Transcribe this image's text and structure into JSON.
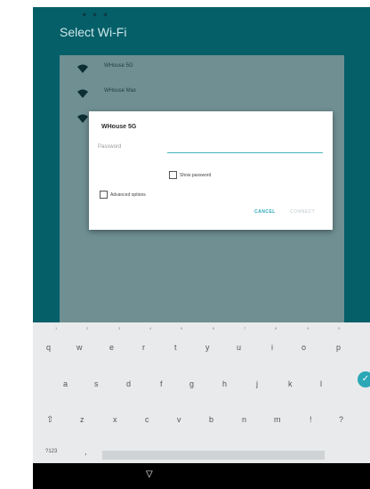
{
  "header": {
    "title": "Select Wi-Fi"
  },
  "networks": [
    {
      "name": "WHouse 5G",
      "icon": "wifi-lock-icon"
    },
    {
      "name": "WHouse Max",
      "icon": "wifi-lock-icon"
    }
  ],
  "dialog": {
    "title": "WHouse 5G",
    "password_label": "Password",
    "password_value": "",
    "show_password_label": "Show password",
    "advanced_options_label": "Advanced options",
    "cancel_label": "CANCEL",
    "connect_label": "CONNECT"
  },
  "keyboard": {
    "row1": [
      "q",
      "w",
      "e",
      "r",
      "t",
      "y",
      "u",
      "i",
      "o",
      "p"
    ],
    "row1_hints": [
      "1",
      "2",
      "3",
      "4",
      "5",
      "6",
      "7",
      "8",
      "9",
      "0"
    ],
    "row2": [
      "a",
      "s",
      "d",
      "f",
      "g",
      "h",
      "j",
      "k",
      "l"
    ],
    "row3": [
      "z",
      "x",
      "c",
      "v",
      "b",
      "n",
      "m",
      "!",
      "?"
    ],
    "row4": {
      "symbols": "?123",
      "comma": ","
    },
    "enter_icon": "check-icon",
    "shift_icon": "shift-icon"
  },
  "navbar": {
    "back_icon": "back-triangle-icon"
  },
  "colors": {
    "accent": "#2ba7b6",
    "device_bg": "#055f68"
  }
}
